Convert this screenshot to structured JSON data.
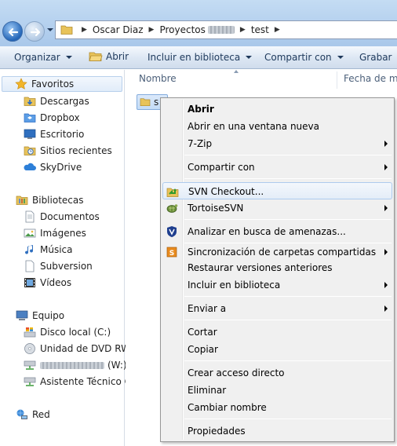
{
  "address": {
    "crumbs": [
      "Oscar Diaz",
      "Proyectos",
      "test"
    ]
  },
  "toolbar": {
    "organize": "Organizar",
    "open": "Abrir",
    "include_library": "Incluir en biblioteca",
    "share_with": "Compartir con",
    "burn": "Grabar"
  },
  "nav": {
    "favorites": "Favoritos",
    "fav_items": [
      "Descargas",
      "Dropbox",
      "Escritorio",
      "Sitios recientes",
      "SkyDrive"
    ],
    "libraries": "Bibliotecas",
    "lib_items": [
      "Documentos",
      "Imágenes",
      "Música",
      "Subversion",
      "Vídeos"
    ],
    "computer": "Equipo",
    "comp_items": [
      "Disco local (C:)",
      "Unidad de DVD RW (",
      "(W:)",
      "Asistente Técnico G"
    ],
    "network": "Red"
  },
  "content": {
    "col_name": "Nombre",
    "col_date": "Fecha de mo",
    "file_name": "s"
  },
  "context_menu": {
    "open": "Abrir",
    "open_new_window": "Abrir en una ventana nueva",
    "zip": "7-Zip",
    "share_with": "Compartir con",
    "svn_checkout": "SVN Checkout...",
    "tortoise": "TortoiseSVN",
    "scan": "Analizar en busca de amenazas...",
    "sync": "Sincronización de carpetas compartidas",
    "restore": "Restaurar versiones anteriores",
    "include_library": "Incluir en biblioteca",
    "send_to": "Enviar a",
    "cut": "Cortar",
    "copy": "Copiar",
    "create_shortcut": "Crear acceso directo",
    "delete": "Eliminar",
    "rename": "Cambiar nombre",
    "properties": "Propiedades"
  },
  "colors": {
    "accent": "#2466b8",
    "menu_bg": "#f0f0f0",
    "selection": "#c3dcf7"
  }
}
